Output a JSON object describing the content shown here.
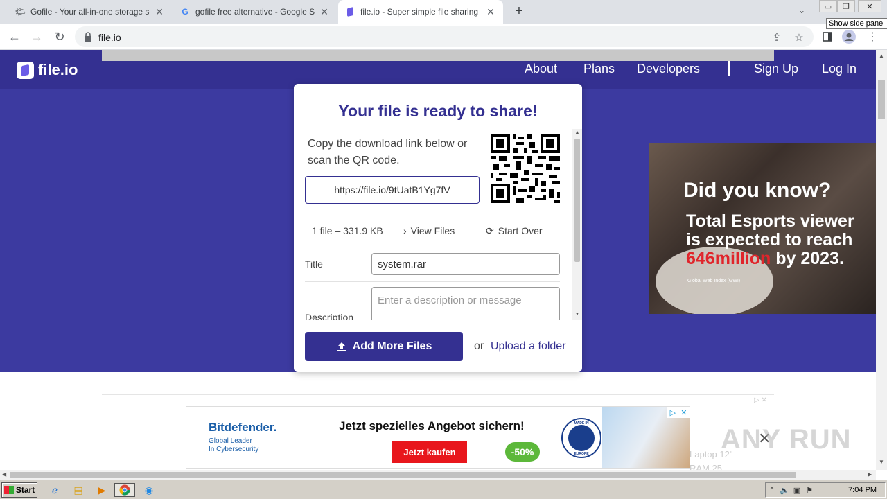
{
  "browser": {
    "tabs": [
      {
        "title": "Gofile - Your all-in-one storage soluti",
        "icon": "gofile-icon"
      },
      {
        "title": "gofile free alternative - Google Such",
        "icon": "google-icon"
      },
      {
        "title": "file.io - Super simple file sharing",
        "icon": "fileio-icon",
        "active": true
      }
    ],
    "url": "file.io",
    "tooltip": "Show side panel"
  },
  "site": {
    "logo": "file.io",
    "nav": [
      "About",
      "Plans",
      "Developers"
    ],
    "auth": [
      "Sign Up",
      "Log In"
    ]
  },
  "card": {
    "title": "Your file is ready to share!",
    "copy_text": "Copy the download link below or scan the QR code.",
    "link": "https://file.io/9tUatB1Yg7fV",
    "file_info": "1 file – 331.9 KB",
    "view_files": "View Files",
    "start_over": "Start Over",
    "title_label": "Title",
    "title_value": "system.rar",
    "description_label": "Description",
    "description_placeholder": "Enter a description or message",
    "add_more": "Add More Files",
    "or": "or",
    "upload_folder": "Upload a folder"
  },
  "side_ad": {
    "headline": "Did you know?",
    "line1": "Total Esports viewer",
    "line2": "is expected to reach",
    "highlight": "646million",
    "line3_rest": " by 2023.",
    "source": "Global Web Index (GWI)"
  },
  "banner": {
    "brand": "Bitdefender.",
    "tagline1": "Global Leader",
    "tagline2": "In Cybersecurity",
    "headline": "Jetzt spezielles Angebot sichern!",
    "cta": "Jetzt kaufen",
    "discount": "-50%",
    "seal_top": "MADE IN",
    "seal_bottom": "EUROPE"
  },
  "overlay": {
    "watermark": "ANY RUN",
    "ghost1": "Laptop 12\"",
    "ghost2": "RAM 25"
  },
  "taskbar": {
    "start": "Start",
    "clock": "7:04 PM"
  }
}
